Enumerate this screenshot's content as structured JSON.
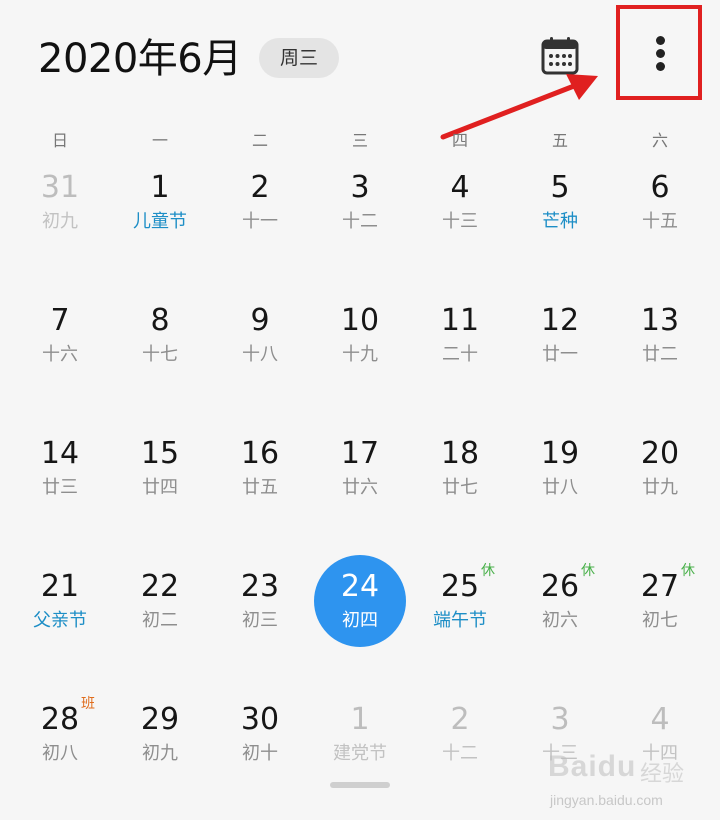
{
  "header": {
    "title": "2020年6月",
    "weekday_chip": "周三"
  },
  "weekdays": [
    "日",
    "一",
    "二",
    "三",
    "四",
    "五",
    "六"
  ],
  "weeks": [
    [
      {
        "day": "31",
        "lunar": "初九",
        "faded": true
      },
      {
        "day": "1",
        "lunar": "儿童节",
        "festival": true
      },
      {
        "day": "2",
        "lunar": "十一"
      },
      {
        "day": "3",
        "lunar": "十二"
      },
      {
        "day": "4",
        "lunar": "十三"
      },
      {
        "day": "5",
        "lunar": "芒种",
        "festival": true
      },
      {
        "day": "6",
        "lunar": "十五"
      }
    ],
    [
      {
        "day": "7",
        "lunar": "十六"
      },
      {
        "day": "8",
        "lunar": "十七"
      },
      {
        "day": "9",
        "lunar": "十八"
      },
      {
        "day": "10",
        "lunar": "十九"
      },
      {
        "day": "11",
        "lunar": "二十"
      },
      {
        "day": "12",
        "lunar": "廿一"
      },
      {
        "day": "13",
        "lunar": "廿二"
      }
    ],
    [
      {
        "day": "14",
        "lunar": "廿三"
      },
      {
        "day": "15",
        "lunar": "廿四"
      },
      {
        "day": "16",
        "lunar": "廿五"
      },
      {
        "day": "17",
        "lunar": "廿六"
      },
      {
        "day": "18",
        "lunar": "廿七"
      },
      {
        "day": "19",
        "lunar": "廿八"
      },
      {
        "day": "20",
        "lunar": "廿九"
      }
    ],
    [
      {
        "day": "21",
        "lunar": "父亲节",
        "festival": true
      },
      {
        "day": "22",
        "lunar": "初二"
      },
      {
        "day": "23",
        "lunar": "初三"
      },
      {
        "day": "24",
        "lunar": "初四",
        "today": true
      },
      {
        "day": "25",
        "lunar": "端午节",
        "festival": true,
        "badge": "休",
        "badge_type": "rest"
      },
      {
        "day": "26",
        "lunar": "初六",
        "badge": "休",
        "badge_type": "rest"
      },
      {
        "day": "27",
        "lunar": "初七",
        "badge": "休",
        "badge_type": "rest"
      }
    ],
    [
      {
        "day": "28",
        "lunar": "初八",
        "badge": "班",
        "badge_type": "work"
      },
      {
        "day": "29",
        "lunar": "初九"
      },
      {
        "day": "30",
        "lunar": "初十"
      },
      {
        "day": "1",
        "lunar": "建党节",
        "faded": true,
        "festival": true
      },
      {
        "day": "2",
        "lunar": "十二",
        "faded": true
      },
      {
        "day": "3",
        "lunar": "十三",
        "faded": true
      },
      {
        "day": "4",
        "lunar": "十四",
        "faded": true
      }
    ]
  ],
  "icons": {
    "calendar": "calendar-icon",
    "more": "more-vertical-icon"
  },
  "colors": {
    "today": "#2e94ef",
    "festival": "#1d8ec6",
    "rest_badge": "#49b04a",
    "work_badge": "#e06c1c",
    "annotation": "#e02020"
  },
  "watermark": {
    "brand": "Baidu",
    "brand_cn": "经验",
    "url": "jingyan.baidu.com"
  }
}
